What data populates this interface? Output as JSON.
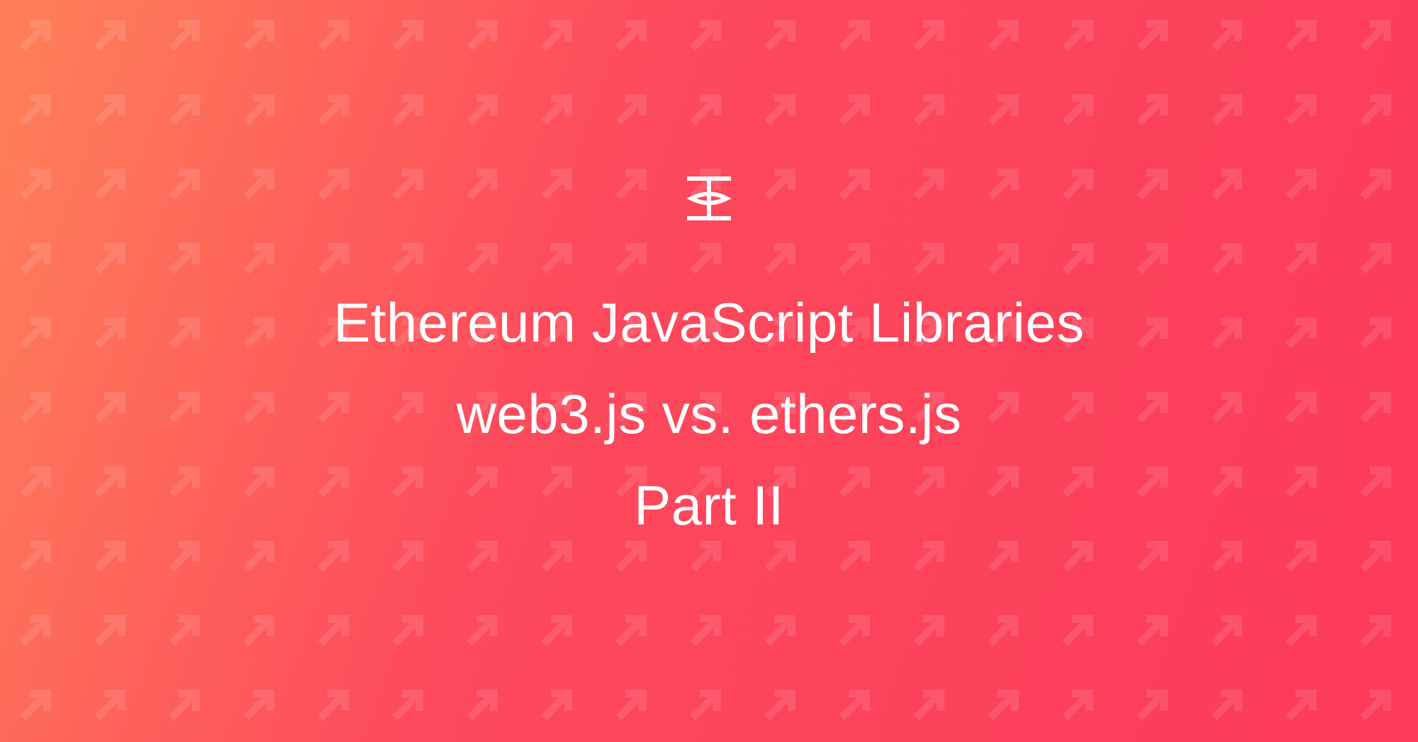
{
  "title": {
    "line1": "Ethereum JavaScript Libraries",
    "line2": "web3.js vs. ethers.js",
    "line3": "Part II"
  },
  "colors": {
    "gradient_start": "#ff8159",
    "gradient_end": "#fc3a5a",
    "text": "#ffffff",
    "pattern_opacity": "0.11"
  }
}
